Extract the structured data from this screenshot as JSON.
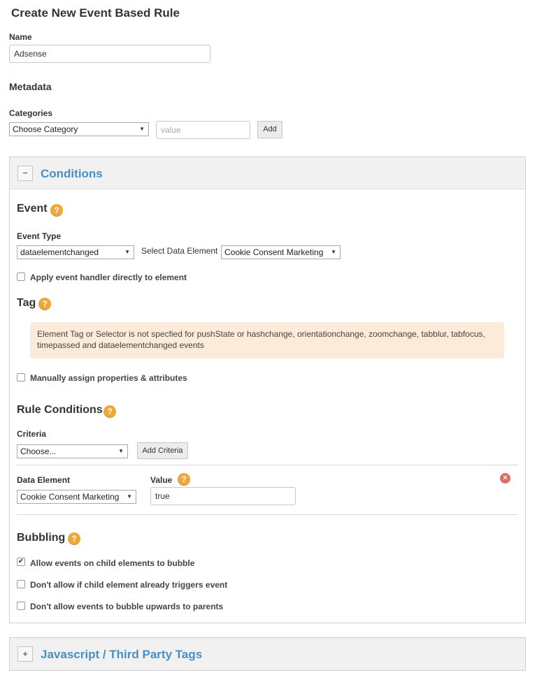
{
  "page": {
    "title": "Create New Event Based Rule"
  },
  "name": {
    "label": "Name",
    "value": "Adsense"
  },
  "metadata": {
    "heading": "Metadata",
    "categories_label": "Categories",
    "category_select": "Choose Category",
    "value_placeholder": "value",
    "add_label": "Add"
  },
  "conditions": {
    "toggle": "−",
    "title": "Conditions",
    "event": {
      "heading": "Event",
      "help": "?",
      "type_label": "Event Type",
      "type_value": "dataelementchanged",
      "data_element_label": "Select Data Element",
      "data_element_value": "Cookie Consent Marketing",
      "apply_handler_label": "Apply event handler directly to element"
    },
    "tag": {
      "heading": "Tag",
      "help": "?",
      "notice": "Element Tag or Selector is not specfied for pushState or hashchange, orientationchange, zoomchange, tabblur, tabfocus, timepassed and dataelementchanged events",
      "manual_label": "Manually assign properties & attributes"
    },
    "rule_conditions": {
      "heading": "Rule Conditions",
      "help": "?",
      "criteria_label": "Criteria",
      "criteria_select": "Choose...",
      "add_criteria_label": "Add Criteria",
      "row": {
        "data_element_label": "Data Element",
        "data_element_value": "Cookie Consent Marketing",
        "value_label": "Value",
        "value_help": "?",
        "value": "true",
        "remove": "×"
      }
    },
    "bubbling": {
      "heading": "Bubbling",
      "help": "?",
      "options": [
        {
          "label": "Allow events on child elements to bubble",
          "checked": true
        },
        {
          "label": "Don't allow if child element already triggers event",
          "checked": false
        },
        {
          "label": "Don't allow events to bubble upwards to parents",
          "checked": false
        }
      ]
    }
  },
  "javascript": {
    "toggle": "+",
    "title": "Javascript / Third Party Tags"
  },
  "colors": {
    "accent": "#4a8fc2",
    "help": "#f0a73a",
    "notice_bg": "#fbebd8",
    "remove": "#e26a6a"
  }
}
